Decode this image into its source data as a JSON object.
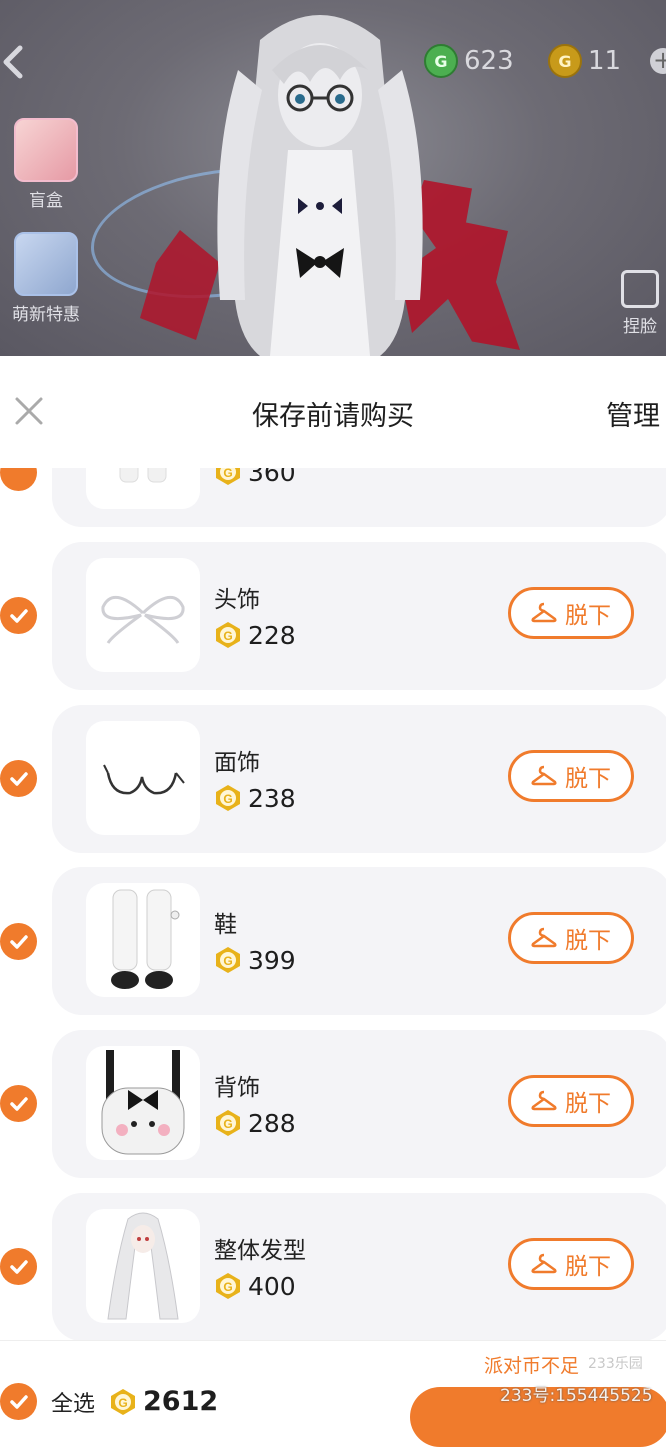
{
  "scene": {
    "currency_green": "623",
    "currency_gold": "11",
    "side_gift_label": "盲盒",
    "side_promo_label": "萌新特惠",
    "side_right_label": "捏脸"
  },
  "sheet": {
    "title": "保存前请购买",
    "manage_label": "管理"
  },
  "items": [
    {
      "name": "",
      "price": "360",
      "action": ""
    },
    {
      "name": "头饰",
      "price": "228",
      "action": "脱下"
    },
    {
      "name": "面饰",
      "price": "238",
      "action": "脱下"
    },
    {
      "name": "鞋",
      "price": "399",
      "action": "脱下"
    },
    {
      "name": "背饰",
      "price": "288",
      "action": "脱下"
    },
    {
      "name": "整体发型",
      "price": "400",
      "action": "脱下"
    }
  ],
  "footer": {
    "insufficient_label": "派对币不足",
    "select_all_label": "全选",
    "total": "2612",
    "watermark_id": "233号:155445525",
    "watermark_logo": "233乐园"
  },
  "colors": {
    "accent": "#f07b2c",
    "card_bg": "#f4f4f7",
    "coin_gold": "#e8b21a"
  }
}
